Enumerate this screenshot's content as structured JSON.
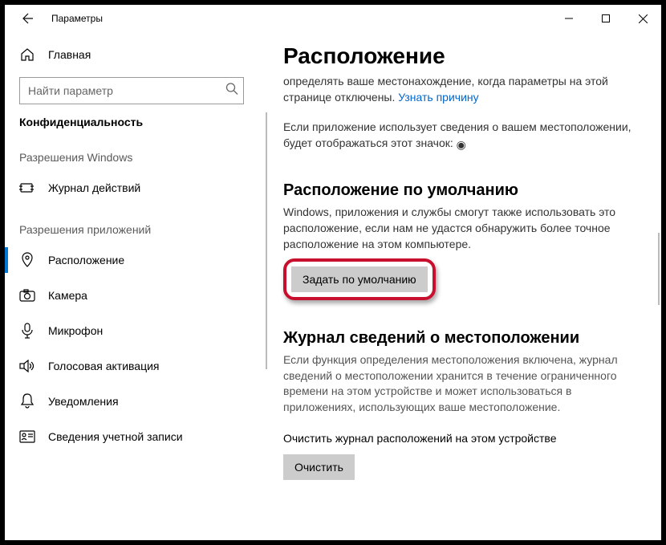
{
  "window": {
    "title": "Параметры"
  },
  "sidebar": {
    "home": "Главная",
    "searchPlaceholder": "Найти параметр",
    "currentSection": "Конфиденциальность",
    "group1Title": "Разрешения Windows",
    "group1Items": [
      {
        "label": "Журнал действий"
      }
    ],
    "group2Title": "Разрешения приложений",
    "group2Items": [
      {
        "label": "Расположение"
      },
      {
        "label": "Камера"
      },
      {
        "label": "Микрофон"
      },
      {
        "label": "Голосовая активация"
      },
      {
        "label": "Уведомления"
      },
      {
        "label": "Сведения учетной записи"
      }
    ]
  },
  "content": {
    "pageTitle": "Расположение",
    "intro1a": "определять ваше местонахождение, когда параметры на этой странице отключены. ",
    "introLink": "Узнать причину",
    "intro2a": "Если приложение использует сведения о вашем местоположении, будет отображаться этот значок: ",
    "indicatorGlyph": "◉",
    "sec1Title": "Расположение по умолчанию",
    "sec1Body": "Windows, приложения и службы смогут также использовать это расположение, если нам не удастся обнаружить более точное расположение на этом компьютере.",
    "sec1Button": "Задать по умолчанию",
    "sec2Title": "Журнал сведений о местоположении",
    "sec2Body": "Если функция определения местоположения включена, журнал сведений о местоположении хранится в течение ограниченного времени на этом устройстве и может использоваться в приложениях, использующих ваше местоположение.",
    "sec2ClearLabel": "Очистить журнал расположений на этом устройстве",
    "sec2Button": "Очистить"
  }
}
